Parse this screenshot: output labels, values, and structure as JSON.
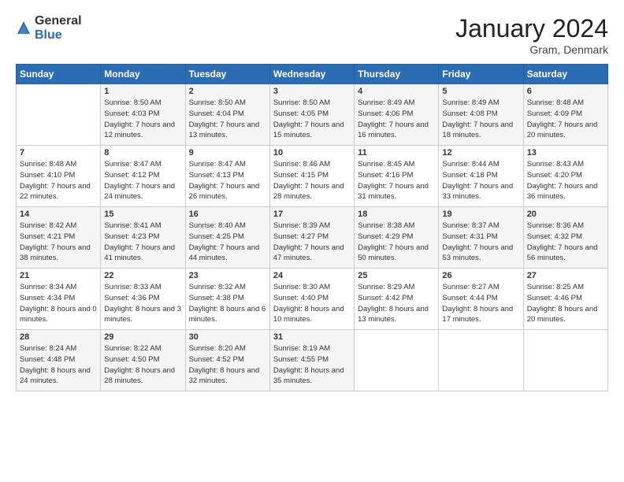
{
  "logo": {
    "general": "General",
    "blue": "Blue"
  },
  "title": "January 2024",
  "location": "Gram, Denmark",
  "days_header": [
    "Sunday",
    "Monday",
    "Tuesday",
    "Wednesday",
    "Thursday",
    "Friday",
    "Saturday"
  ],
  "weeks": [
    [
      {
        "day": "",
        "sunrise": "",
        "sunset": "",
        "daylight": ""
      },
      {
        "day": "1",
        "sunrise": "Sunrise: 8:50 AM",
        "sunset": "Sunset: 4:03 PM",
        "daylight": "Daylight: 7 hours and 12 minutes."
      },
      {
        "day": "2",
        "sunrise": "Sunrise: 8:50 AM",
        "sunset": "Sunset: 4:04 PM",
        "daylight": "Daylight: 7 hours and 13 minutes."
      },
      {
        "day": "3",
        "sunrise": "Sunrise: 8:50 AM",
        "sunset": "Sunset: 4:05 PM",
        "daylight": "Daylight: 7 hours and 15 minutes."
      },
      {
        "day": "4",
        "sunrise": "Sunrise: 8:49 AM",
        "sunset": "Sunset: 4:06 PM",
        "daylight": "Daylight: 7 hours and 16 minutes."
      },
      {
        "day": "5",
        "sunrise": "Sunrise: 8:49 AM",
        "sunset": "Sunset: 4:08 PM",
        "daylight": "Daylight: 7 hours and 18 minutes."
      },
      {
        "day": "6",
        "sunrise": "Sunrise: 8:48 AM",
        "sunset": "Sunset: 4:09 PM",
        "daylight": "Daylight: 7 hours and 20 minutes."
      }
    ],
    [
      {
        "day": "7",
        "sunrise": "Sunrise: 8:48 AM",
        "sunset": "Sunset: 4:10 PM",
        "daylight": "Daylight: 7 hours and 22 minutes."
      },
      {
        "day": "8",
        "sunrise": "Sunrise: 8:47 AM",
        "sunset": "Sunset: 4:12 PM",
        "daylight": "Daylight: 7 hours and 24 minutes."
      },
      {
        "day": "9",
        "sunrise": "Sunrise: 8:47 AM",
        "sunset": "Sunset: 4:13 PM",
        "daylight": "Daylight: 7 hours and 26 minutes."
      },
      {
        "day": "10",
        "sunrise": "Sunrise: 8:46 AM",
        "sunset": "Sunset: 4:15 PM",
        "daylight": "Daylight: 7 hours and 28 minutes."
      },
      {
        "day": "11",
        "sunrise": "Sunrise: 8:45 AM",
        "sunset": "Sunset: 4:16 PM",
        "daylight": "Daylight: 7 hours and 31 minutes."
      },
      {
        "day": "12",
        "sunrise": "Sunrise: 8:44 AM",
        "sunset": "Sunset: 4:18 PM",
        "daylight": "Daylight: 7 hours and 33 minutes."
      },
      {
        "day": "13",
        "sunrise": "Sunrise: 8:43 AM",
        "sunset": "Sunset: 4:20 PM",
        "daylight": "Daylight: 7 hours and 36 minutes."
      }
    ],
    [
      {
        "day": "14",
        "sunrise": "Sunrise: 8:42 AM",
        "sunset": "Sunset: 4:21 PM",
        "daylight": "Daylight: 7 hours and 38 minutes."
      },
      {
        "day": "15",
        "sunrise": "Sunrise: 8:41 AM",
        "sunset": "Sunset: 4:23 PM",
        "daylight": "Daylight: 7 hours and 41 minutes."
      },
      {
        "day": "16",
        "sunrise": "Sunrise: 8:40 AM",
        "sunset": "Sunset: 4:25 PM",
        "daylight": "Daylight: 7 hours and 44 minutes."
      },
      {
        "day": "17",
        "sunrise": "Sunrise: 8:39 AM",
        "sunset": "Sunset: 4:27 PM",
        "daylight": "Daylight: 7 hours and 47 minutes."
      },
      {
        "day": "18",
        "sunrise": "Sunrise: 8:38 AM",
        "sunset": "Sunset: 4:29 PM",
        "daylight": "Daylight: 7 hours and 50 minutes."
      },
      {
        "day": "19",
        "sunrise": "Sunrise: 8:37 AM",
        "sunset": "Sunset: 4:31 PM",
        "daylight": "Daylight: 7 hours and 53 minutes."
      },
      {
        "day": "20",
        "sunrise": "Sunrise: 8:36 AM",
        "sunset": "Sunset: 4:32 PM",
        "daylight": "Daylight: 7 hours and 56 minutes."
      }
    ],
    [
      {
        "day": "21",
        "sunrise": "Sunrise: 8:34 AM",
        "sunset": "Sunset: 4:34 PM",
        "daylight": "Daylight: 8 hours and 0 minutes."
      },
      {
        "day": "22",
        "sunrise": "Sunrise: 8:33 AM",
        "sunset": "Sunset: 4:36 PM",
        "daylight": "Daylight: 8 hours and 3 minutes."
      },
      {
        "day": "23",
        "sunrise": "Sunrise: 8:32 AM",
        "sunset": "Sunset: 4:38 PM",
        "daylight": "Daylight: 8 hours and 6 minutes."
      },
      {
        "day": "24",
        "sunrise": "Sunrise: 8:30 AM",
        "sunset": "Sunset: 4:40 PM",
        "daylight": "Daylight: 8 hours and 10 minutes."
      },
      {
        "day": "25",
        "sunrise": "Sunrise: 8:29 AM",
        "sunset": "Sunset: 4:42 PM",
        "daylight": "Daylight: 8 hours and 13 minutes."
      },
      {
        "day": "26",
        "sunrise": "Sunrise: 8:27 AM",
        "sunset": "Sunset: 4:44 PM",
        "daylight": "Daylight: 8 hours and 17 minutes."
      },
      {
        "day": "27",
        "sunrise": "Sunrise: 8:25 AM",
        "sunset": "Sunset: 4:46 PM",
        "daylight": "Daylight: 8 hours and 20 minutes."
      }
    ],
    [
      {
        "day": "28",
        "sunrise": "Sunrise: 8:24 AM",
        "sunset": "Sunset: 4:48 PM",
        "daylight": "Daylight: 8 hours and 24 minutes."
      },
      {
        "day": "29",
        "sunrise": "Sunrise: 8:22 AM",
        "sunset": "Sunset: 4:50 PM",
        "daylight": "Daylight: 8 hours and 28 minutes."
      },
      {
        "day": "30",
        "sunrise": "Sunrise: 8:20 AM",
        "sunset": "Sunset: 4:52 PM",
        "daylight": "Daylight: 8 hours and 32 minutes."
      },
      {
        "day": "31",
        "sunrise": "Sunrise: 8:19 AM",
        "sunset": "Sunset: 4:55 PM",
        "daylight": "Daylight: 8 hours and 35 minutes."
      },
      {
        "day": "",
        "sunrise": "",
        "sunset": "",
        "daylight": ""
      },
      {
        "day": "",
        "sunrise": "",
        "sunset": "",
        "daylight": ""
      },
      {
        "day": "",
        "sunrise": "",
        "sunset": "",
        "daylight": ""
      }
    ]
  ]
}
